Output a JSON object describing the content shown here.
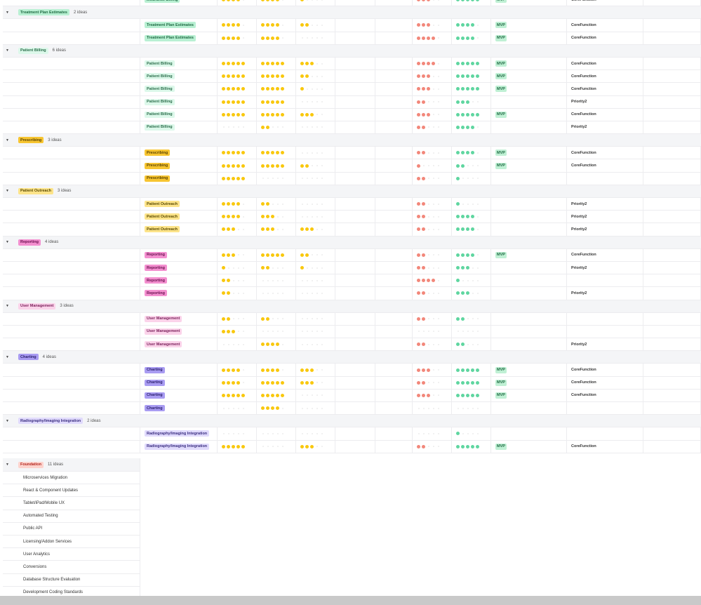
{
  "colors": {
    "yellow": "#f9c80e",
    "red": "#f2877a",
    "green": "#5fd6a0"
  },
  "top_row": {
    "tag": "Insurance Billing",
    "tag_style": "green",
    "d": [
      4,
      4,
      1,
      3,
      5
    ],
    "mvp": "MVP",
    "priority": "CoreFunction"
  },
  "groups": [
    {
      "name": "Treatment Plan Estimates",
      "count": "2 ideas",
      "style": "green",
      "rows": [
        {
          "tag": "Treatment Plan Estimates",
          "d": [
            4,
            4,
            2,
            3,
            4
          ],
          "mvp": "MVP",
          "priority": "CoreFunction"
        },
        {
          "tag": "Treatment Plan Estimates",
          "d": [
            4,
            4,
            0,
            4,
            4
          ],
          "mvp": "MVP",
          "priority": "CoreFunction"
        }
      ]
    },
    {
      "name": "Patient Billing",
      "count": "6 ideas",
      "style": "lgreen",
      "rows": [
        {
          "tag": "Patient Billing",
          "d": [
            5,
            5,
            3,
            4,
            5
          ],
          "mvp": "MVP",
          "priority": "CoreFunction"
        },
        {
          "tag": "Patient Billing",
          "d": [
            5,
            5,
            2,
            3,
            5
          ],
          "mvp": "MVP",
          "priority": "CoreFunction"
        },
        {
          "tag": "Patient Billing",
          "d": [
            5,
            5,
            1,
            3,
            5
          ],
          "mvp": "MVP",
          "priority": "CoreFunction"
        },
        {
          "tag": "Patient Billing",
          "d": [
            5,
            5,
            0,
            2,
            3
          ],
          "mvp": "",
          "priority": "Priority2"
        },
        {
          "tag": "Patient Billing",
          "d": [
            5,
            5,
            3,
            3,
            5
          ],
          "mvp": "MVP",
          "priority": "CoreFunction"
        },
        {
          "tag": "Patient Billing",
          "d": [
            0,
            2,
            0,
            2,
            4
          ],
          "mvp": "",
          "priority": "Priority2"
        }
      ]
    },
    {
      "name": "Prescribing",
      "count": "3 ideas",
      "style": "yellow",
      "rows": [
        {
          "tag": "Prescribing",
          "d": [
            5,
            5,
            0,
            2,
            4
          ],
          "mvp": "MVP",
          "priority": "CoreFunction"
        },
        {
          "tag": "Prescribing",
          "d": [
            5,
            5,
            2,
            1,
            2
          ],
          "mvp": "MVP",
          "priority": "CoreFunction"
        },
        {
          "tag": "Prescribing",
          "d": [
            5,
            0,
            0,
            2,
            1
          ],
          "mvp": "",
          "priority": ""
        }
      ]
    },
    {
      "name": "Patient Outreach",
      "count": "3 ideas",
      "style": "lyellow",
      "rows": [
        {
          "tag": "Patient Outreach",
          "d": [
            4,
            2,
            0,
            2,
            1
          ],
          "mvp": "",
          "priority": "Priority2"
        },
        {
          "tag": "Patient Outreach",
          "d": [
            4,
            3,
            0,
            2,
            4
          ],
          "mvp": "",
          "priority": "Priority2"
        },
        {
          "tag": "Patient Outreach",
          "d": [
            3,
            3,
            3,
            2,
            4
          ],
          "mvp": "",
          "priority": "Priority2"
        }
      ]
    },
    {
      "name": "Reporting",
      "count": "4 ideas",
      "style": "pink",
      "rows": [
        {
          "tag": "Reporting",
          "d": [
            3,
            5,
            2,
            2,
            4
          ],
          "mvp": "MVP",
          "priority": "CoreFunction"
        },
        {
          "tag": "Reporting",
          "d": [
            1,
            2,
            1,
            2,
            3
          ],
          "mvp": "",
          "priority": "Priority2"
        },
        {
          "tag": "Reporting",
          "d": [
            2,
            0,
            0,
            4,
            1
          ],
          "mvp": "",
          "priority": ""
        },
        {
          "tag": "Reporting",
          "d": [
            2,
            0,
            0,
            2,
            3
          ],
          "mvp": "",
          "priority": "Priority2"
        }
      ]
    },
    {
      "name": "User Management",
      "count": "3 ideas",
      "style": "lpink",
      "rows": [
        {
          "tag": "User Management",
          "d": [
            2,
            2,
            0,
            2,
            2
          ],
          "mvp": "",
          "priority": ""
        },
        {
          "tag": "User Management",
          "d": [
            3,
            0,
            0,
            0,
            0
          ],
          "mvp": "",
          "priority": ""
        },
        {
          "tag": "User Management",
          "d": [
            0,
            4,
            0,
            2,
            2
          ],
          "mvp": "",
          "priority": "Priority2"
        }
      ]
    },
    {
      "name": "Charting",
      "count": "4 ideas",
      "style": "purple",
      "rows": [
        {
          "tag": "Charting",
          "d": [
            4,
            4,
            3,
            3,
            5
          ],
          "mvp": "MVP",
          "priority": "CoreFunction"
        },
        {
          "tag": "Charting",
          "d": [
            4,
            5,
            3,
            2,
            5
          ],
          "mvp": "MVP",
          "priority": "CoreFunction"
        },
        {
          "tag": "Charting",
          "d": [
            5,
            5,
            0,
            3,
            5
          ],
          "mvp": "MVP",
          "priority": "CoreFunction"
        },
        {
          "tag": "Charting",
          "d": [
            0,
            4,
            0,
            0,
            0
          ],
          "mvp": "",
          "priority": ""
        }
      ]
    },
    {
      "name": "Radiography/Imaging Integration",
      "count": "2 ideas",
      "style": "lpurple",
      "rows": [
        {
          "tag": "Radiography/Imaging Integration",
          "d": [
            0,
            0,
            0,
            0,
            1
          ],
          "mvp": "",
          "priority": ""
        },
        {
          "tag": "Radiography/Imaging Integration",
          "d": [
            5,
            0,
            3,
            2,
            5
          ],
          "mvp": "MVP",
          "priority": "CoreFunction"
        }
      ]
    }
  ],
  "tag_styles": {
    "green": {
      "bg": "#b9f0d3",
      "fg": "#1f6b43"
    },
    "lgreen": {
      "bg": "#dcf8ea",
      "fg": "#2b6e4b"
    },
    "yellow": {
      "bg": "#f7c531",
      "fg": "#5a4200"
    },
    "lyellow": {
      "bg": "#fde48a",
      "fg": "#5a4a00"
    },
    "pink": {
      "bg": "#f38fcf",
      "fg": "#6b1150"
    },
    "lpink": {
      "bg": "#fbd3ea",
      "fg": "#7a1f5a"
    },
    "purple": {
      "bg": "#a99cf2",
      "fg": "#2d2170"
    },
    "lpurple": {
      "bg": "#e0dafc",
      "fg": "#3b2f80"
    },
    "red": {
      "bg": "#fdd3cd",
      "fg": "#b3261e"
    }
  },
  "foundation": {
    "name": "Foundation",
    "count": "11 ideas",
    "style": "red",
    "items": [
      "Microservices Migration",
      "React & Component Updates",
      "Tablet/iPad/Mobile UX",
      "Automated Testing",
      "Public API",
      "Licensing/Addon Services",
      "User Analytics",
      "Conversions",
      "Database Structure Evaluation",
      "Development Coding Standards"
    ]
  }
}
